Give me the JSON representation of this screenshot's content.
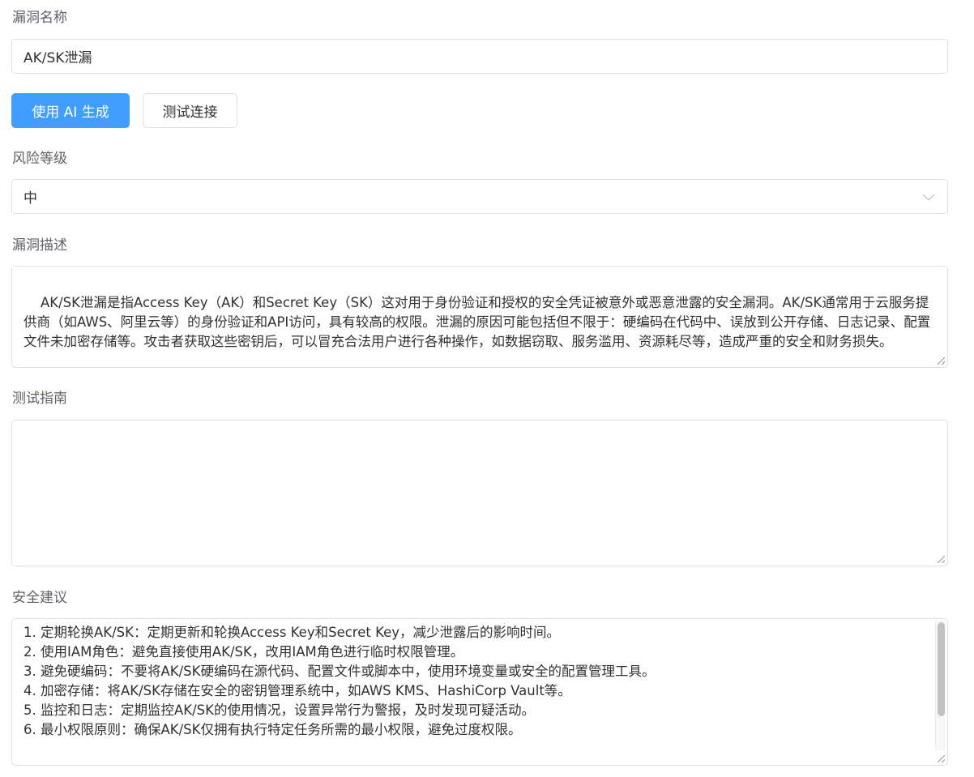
{
  "form": {
    "name_label": "漏洞名称",
    "name_value": "AK/SK泄漏",
    "ai_button": "使用 AI 生成",
    "test_button": "测试连接",
    "risk_label": "风险等级",
    "risk_value": "中",
    "desc_label": "漏洞描述",
    "desc_value": "AK/SK泄漏是指Access Key（AK）和Secret Key（SK）这对用于身份验证和授权的安全凭证被意外或恶意泄露的安全漏洞。AK/SK通常用于云服务提供商（如AWS、阿里云等）的身份验证和API访问，具有较高的权限。泄漏的原因可能包括但不限于：硬编码在代码中、误放到公开存储、日志记录、配置文件未加密存储等。攻击者获取这些密钥后，可以冒充合法用户进行各种操作，如数据窃取、服务滥用、资源耗尽等，造成严重的安全和财务损失。",
    "guide_label": "测试指南",
    "guide_value": "",
    "advice_label": "安全建议",
    "advice_lines": [
      "1. 定期轮换AK/SK：定期更新和轮换Access Key和Secret Key，减少泄露后的影响时间。",
      "2. 使用IAM角色：避免直接使用AK/SK，改用IAM角色进行临时权限管理。",
      "3. 避免硬编码：不要将AK/SK硬编码在源代码、配置文件或脚本中，使用环境变量或安全的配置管理工具。",
      "4. 加密存储：将AK/SK存储在安全的密钥管理系统中，如AWS KMS、HashiCorp Vault等。",
      "5. 监控和日志：定期监控AK/SK的使用情况，设置异常行为警报，及时发现可疑活动。",
      "6. 最小权限原则：确保AK/SK仅拥有执行特定任务所需的最小权限，避免过度权限。"
    ]
  },
  "colors": {
    "primary": "#409eff",
    "border": "#dcdfe6",
    "label": "#5f6066"
  }
}
